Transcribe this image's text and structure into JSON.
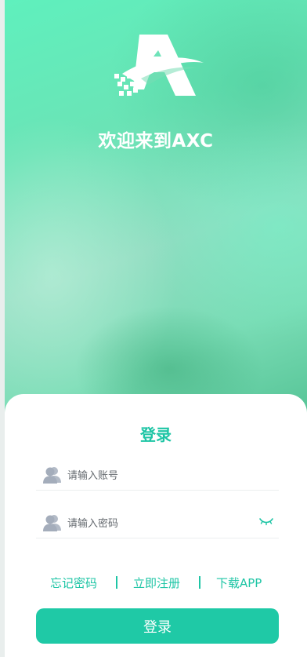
{
  "hero": {
    "welcome_text": "欢迎来到AXC"
  },
  "login": {
    "title": "登录",
    "account_placeholder": "请输入账号",
    "password_placeholder": "请输入密码",
    "forgot_password": "忘记密码",
    "register_now": "立即注册",
    "download_app": "下载APP",
    "submit_label": "登录"
  },
  "icons": {
    "logo": "axc-logo-icon",
    "account": "user-icon",
    "password": "user-icon",
    "password_toggle": "eye-closed-icon"
  },
  "colors": {
    "accent": "#1ec5a5",
    "button": "#1fc9a6",
    "hero_start": "#5ff0bd",
    "hero_end": "#4fbf90",
    "icon_gray": "#a4adbb"
  }
}
